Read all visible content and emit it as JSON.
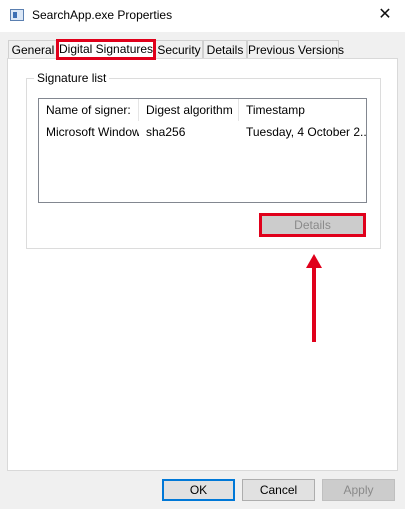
{
  "window": {
    "title": "SearchApp.exe Properties",
    "close_glyph": "✕",
    "icon": "app-window-icon"
  },
  "tabs": [
    {
      "label": "General",
      "active": false
    },
    {
      "label": "Digital Signatures",
      "active": true
    },
    {
      "label": "Security",
      "active": false
    },
    {
      "label": "Details",
      "active": false
    },
    {
      "label": "Previous Versions",
      "active": false
    }
  ],
  "signature_group": {
    "label": "Signature list",
    "columns": [
      "Name of signer:",
      "Digest algorithm",
      "Timestamp"
    ],
    "rows": [
      [
        "Microsoft Windows",
        "sha256",
        "Tuesday, 4 October 2..."
      ]
    ],
    "details_label": "Details"
  },
  "footer": {
    "ok_label": "OK",
    "cancel_label": "Cancel",
    "apply_label": "Apply"
  },
  "colors": {
    "highlight": "#e0001b",
    "default_button_border": "#0078d7"
  }
}
